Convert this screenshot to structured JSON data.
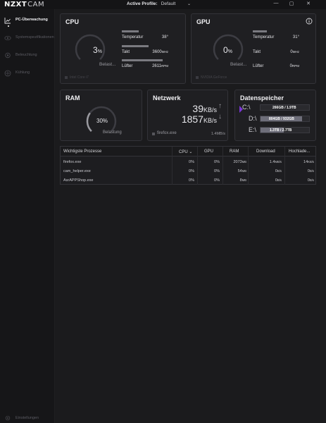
{
  "app": {
    "logo_main": "NZXT",
    "logo_sub": "CAM"
  },
  "header": {
    "profile_label": "Active Profile:",
    "profile_value": "Default"
  },
  "sidebar": {
    "items": [
      {
        "label": "PC-Überwachung",
        "icon": "chart-icon",
        "active": true
      },
      {
        "label": "Systemspezifikationen",
        "icon": "eye-icon",
        "active": false
      },
      {
        "label": "Beleuchtung",
        "icon": "bulb-icon",
        "active": false
      },
      {
        "label": "Kühlung",
        "icon": "fan-icon",
        "active": false
      }
    ],
    "settings_label": "Einstellungen"
  },
  "cpu": {
    "title": "CPU",
    "load": "3",
    "load_unit": "%",
    "load_label": "Belast...",
    "load_fraction": 0.03,
    "temp_label": "Temperatur",
    "temp_value": "38°",
    "temp_fraction": 0.38,
    "clock_label": "Takt",
    "clock_value": "3600",
    "clock_unit": "MHz",
    "clock_fraction": 0.6,
    "fan_label": "Lüfter",
    "fan_value": "2611",
    "fan_unit": "RPM",
    "fan_fraction": 0.9,
    "footer": "Intel Core i7"
  },
  "gpu": {
    "title": "GPU",
    "load": "0",
    "load_unit": "%",
    "load_label": "Belast...",
    "load_fraction": 0.0,
    "temp_label": "Temperatur",
    "temp_value": "31°",
    "temp_fraction": 0.31,
    "clock_label": "Takt",
    "clock_value": "0",
    "clock_unit": "MHz",
    "clock_fraction": 0.0,
    "fan_label": "Lüfter",
    "fan_value": "0",
    "fan_unit": "RPM",
    "fan_fraction": 0.0,
    "footer": "NVIDIA GeForce"
  },
  "ram": {
    "title": "RAM",
    "load": "30%",
    "load_label": "Belastung",
    "load_fraction": 0.3
  },
  "network": {
    "title": "Netzwerk",
    "down_value": "39",
    "down_unit": "KB/s",
    "up_value": "1857",
    "up_unit": "KB/s",
    "top_app": "firefox.exe",
    "top_app_rate": "1.4MB/s"
  },
  "storage": {
    "title": "Datenspeicher",
    "drives": [
      {
        "label": "C:\\",
        "usage": "266GB / 1.9TB",
        "fraction": 0.14,
        "color": "#2a2a2e",
        "selected": true
      },
      {
        "label": "D:\\",
        "usage": "804GB / 932GB",
        "fraction": 0.86,
        "color": "#6e6e7a",
        "selected": false
      },
      {
        "label": "E:\\",
        "usage": "1.3TB / 2.7TB",
        "fraction": 0.48,
        "color": "#6e6e7a",
        "selected": false
      }
    ]
  },
  "processes": {
    "headers": {
      "name": "Wichtigste Prozesse",
      "cpu": "CPU",
      "gpu": "GPU",
      "ram": "RAM",
      "download": "Download",
      "upload": "Hochlade..."
    },
    "rows": [
      {
        "name": "firefox.exe",
        "cpu": "0%",
        "gpu": "0%",
        "ram": "2073",
        "ram_unit": "MB",
        "download": "1.4",
        "download_unit": "MB/s",
        "upload": "14",
        "upload_unit": "KB/s"
      },
      {
        "name": "cam_helper.exe",
        "cpu": "0%",
        "gpu": "0%",
        "ram": "54",
        "ram_unit": "MB",
        "download": "0",
        "download_unit": "B/s",
        "upload": "0",
        "upload_unit": "B/s"
      },
      {
        "name": "AsrAPPShop.exe",
        "cpu": "0%",
        "gpu": "0%",
        "ram": "8",
        "ram_unit": "MB",
        "download": "0",
        "download_unit": "B/s",
        "upload": "0",
        "upload_unit": "B/s"
      }
    ]
  },
  "colors": {
    "accent": "#7b35d6",
    "bg": "#1b1b1d",
    "card": "#1f1f22"
  }
}
